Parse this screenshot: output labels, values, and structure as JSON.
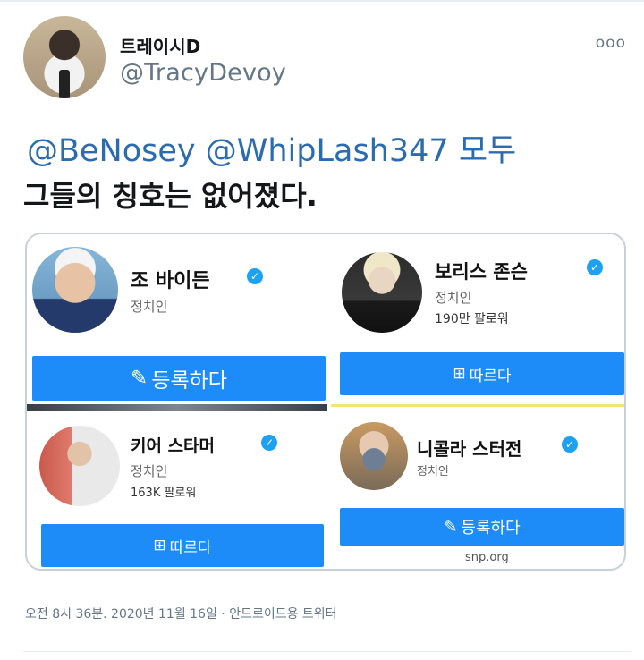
{
  "header": {
    "display_name": "트레이시D",
    "handle": "@TracyDevoy",
    "more_icon": "ooo"
  },
  "tweet": {
    "mention1": "@BeNosey",
    "mention2": "@WhipLash347",
    "mention_suffix": "모두",
    "line2": "그들의 칭호는 없어졌다."
  },
  "card": {
    "people": [
      {
        "name": "조 바이든",
        "role": "정치인",
        "followers": "",
        "button_label": "등록하다",
        "button_icon": "pencil-icon"
      },
      {
        "name": "보리스 존슨",
        "role": "정치인",
        "followers": "190만 팔로워",
        "button_label": "따르다",
        "button_icon": "add-follow-icon"
      },
      {
        "name": "키어 스타머",
        "role": "정치인",
        "followers": "163K 팔로워",
        "button_label": "따르다",
        "button_icon": "add-follow-icon"
      },
      {
        "name": "니콜라 스터전",
        "role": "정치인",
        "followers": "",
        "button_label": "등록하다",
        "button_icon": "pencil-icon"
      }
    ],
    "source": "snp.org"
  },
  "footer": {
    "timestamp": "오전 8시 36분. 2020년 11월 16일 · 안드로이드용 트위터"
  },
  "colors": {
    "accent": "#1d8cf8",
    "mention": "#2b6cb0",
    "verified": "#1da1f2"
  }
}
